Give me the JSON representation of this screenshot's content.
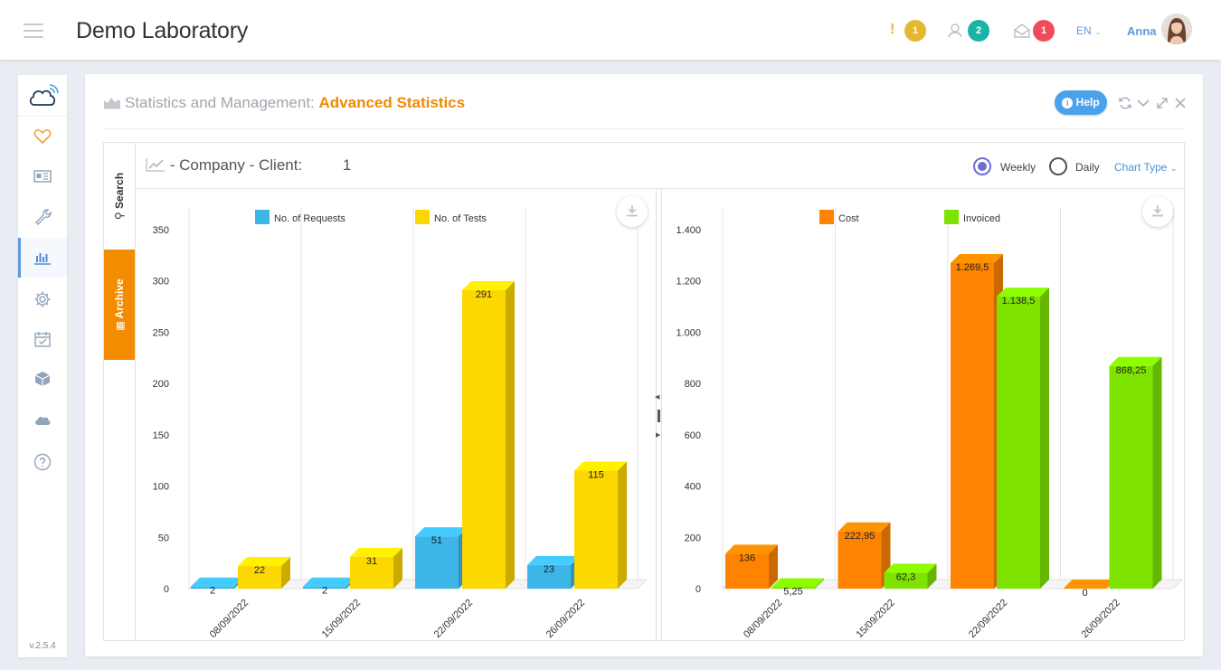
{
  "app": {
    "title": "Demo Laboratory",
    "version": "v.2.5.4"
  },
  "topbar": {
    "alerts": {
      "count": "1",
      "glyph": "!",
      "color": "#e5b732"
    },
    "users": {
      "count": "2",
      "color": "#1ab3a6"
    },
    "messages": {
      "count": "1",
      "color": "#ef4b5a"
    },
    "language": "EN",
    "user": "Anna"
  },
  "sidebar": {
    "items": [
      {
        "icon": "heart-icon"
      },
      {
        "icon": "newspaper-icon"
      },
      {
        "icon": "wrench-icon"
      },
      {
        "icon": "bar-chart-icon",
        "active": true
      },
      {
        "icon": "gear-icon"
      },
      {
        "icon": "calendar-check-icon"
      },
      {
        "icon": "box-icon"
      },
      {
        "icon": "cloud-icon"
      },
      {
        "icon": "question-icon"
      }
    ]
  },
  "card": {
    "title_prefix": "Statistics and Management:",
    "title_highlight": "Advanced Statistics",
    "help_label": "Help"
  },
  "panel": {
    "tabs": {
      "search": "Search",
      "archive": "Archive"
    },
    "heading": "- Company - Client:",
    "heading_value": "1",
    "period_options": [
      "Weekly",
      "Daily"
    ],
    "period_selected": "Weekly",
    "chart_type_label": "Chart Type"
  },
  "chart_data": [
    {
      "type": "bar",
      "categories": [
        "08/09/2022",
        "15/09/2022",
        "22/09/2022",
        "26/09/2022"
      ],
      "series": [
        {
          "name": "No. of Requests",
          "values": [
            2,
            2,
            51,
            23
          ],
          "labels": [
            "2",
            "2",
            "51",
            "23"
          ],
          "color": "#3db5e6"
        },
        {
          "name": "No. of Tests",
          "values": [
            22,
            31,
            291,
            115
          ],
          "labels": [
            "22",
            "31",
            "291",
            "115"
          ],
          "color": "#fdd700"
        }
      ],
      "yticks": [
        "0",
        "50",
        "100",
        "150",
        "200",
        "250",
        "300",
        "350"
      ],
      "ylim": [
        0,
        350
      ],
      "legend": "top",
      "grid": "vertical"
    },
    {
      "type": "bar",
      "categories": [
        "08/09/2022",
        "15/09/2022",
        "22/09/2022",
        "26/09/2022"
      ],
      "series": [
        {
          "name": "Cost",
          "values": [
            136,
            222.95,
            1269.5,
            0
          ],
          "labels": [
            "136",
            "222,95",
            "1.269,5",
            "0"
          ],
          "color": "#fd8300"
        },
        {
          "name": "Invoiced",
          "values": [
            5.25,
            62.3,
            1138.5,
            868.25
          ],
          "labels": [
            "5,25",
            "62,3",
            "1.138,5",
            "868,25"
          ],
          "color": "#7ee300"
        }
      ],
      "yticks": [
        "0",
        "200",
        "400",
        "600",
        "800",
        "1.000",
        "1.200",
        "1.400"
      ],
      "ylim": [
        0,
        1400
      ],
      "legend": "top",
      "grid": "vertical"
    }
  ]
}
